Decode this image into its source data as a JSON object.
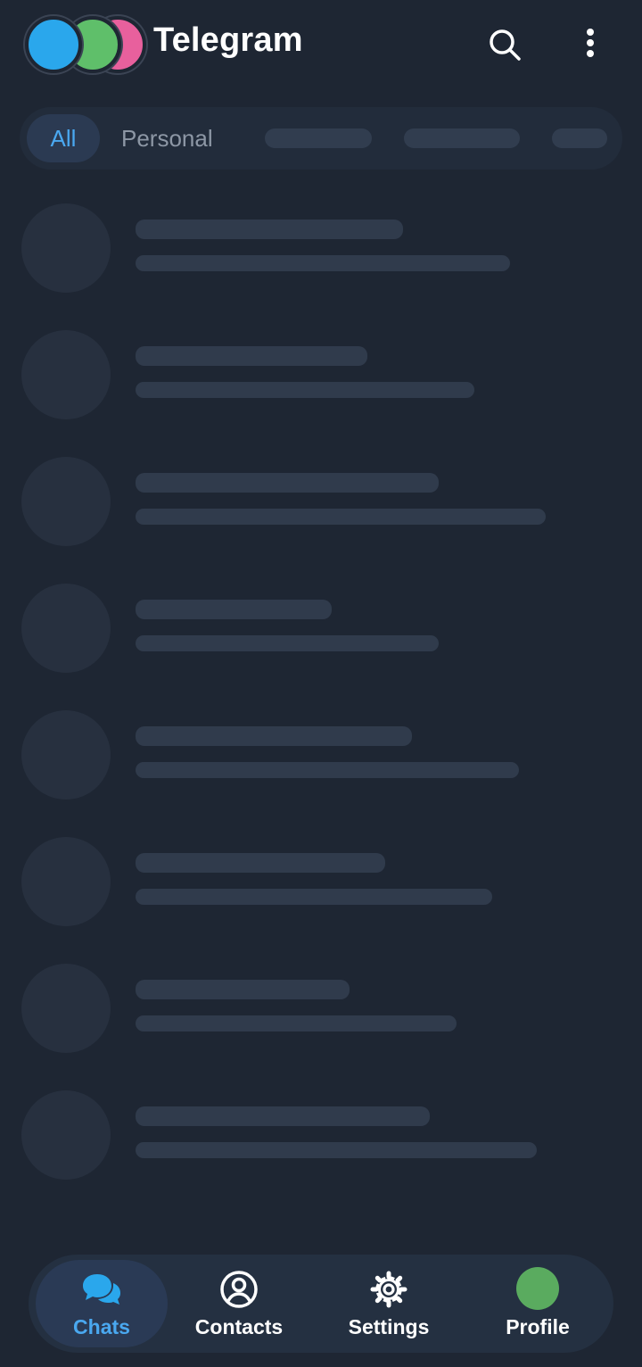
{
  "header": {
    "title": "Telegram",
    "account_avatars": [
      {
        "color": "#2aa7ec"
      },
      {
        "color": "#5fbf6a"
      },
      {
        "color": "#e8609d"
      }
    ],
    "icons": [
      "search-icon",
      "more-vert-icon"
    ]
  },
  "filters": {
    "tabs": [
      {
        "label": "All",
        "selected": true
      },
      {
        "label": "Personal",
        "selected": false
      }
    ],
    "loading_placeholder_count": 3
  },
  "chat_list": {
    "state": "loading",
    "placeholder_count": 8
  },
  "bottom_nav": {
    "items": [
      {
        "label": "Chats",
        "icon": "chats-icon",
        "active": true
      },
      {
        "label": "Contacts",
        "icon": "contacts-icon",
        "active": false
      },
      {
        "label": "Settings",
        "icon": "settings-icon",
        "active": false
      },
      {
        "label": "Profile",
        "icon": "profile-avatar",
        "active": false
      }
    ]
  },
  "colors": {
    "background": "#1e2633",
    "accent": "#4aa8f0",
    "skeleton": "#303b4c",
    "profile_avatar": "#5aab5f"
  }
}
